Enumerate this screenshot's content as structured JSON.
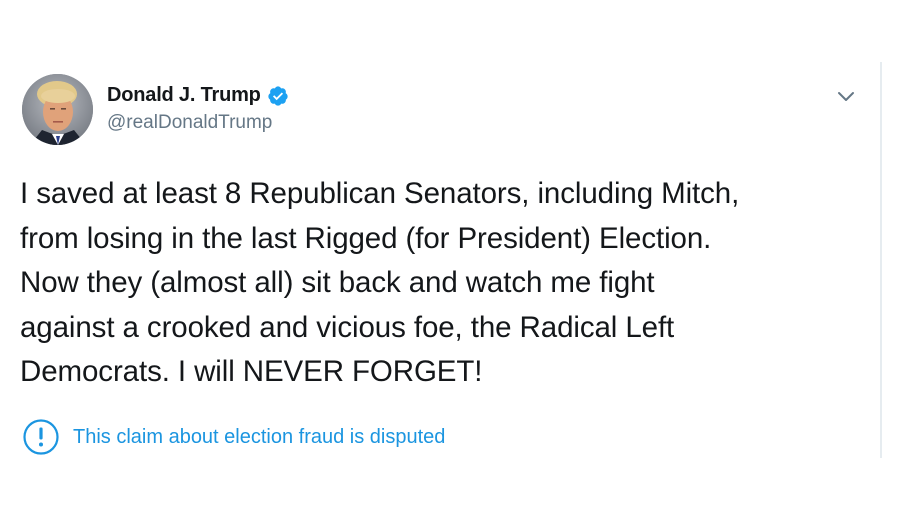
{
  "tweet": {
    "display_name": "Donald J. Trump",
    "handle": "@realDonaldTrump",
    "verified": true,
    "avatar_icon": "profile-photo",
    "text_lines": [
      "I saved at least 8 Republican Senators, including Mitch,",
      "from losing in the last Rigged (for President) Election.",
      "Now they (almost all) sit back and watch me fight",
      "against a crooked and vicious foe, the Radical Left",
      "Democrats. I will NEVER FORGET!"
    ],
    "notice": {
      "icon": "exclamation-circle-icon",
      "label": "This claim about election fraud is disputed"
    },
    "menu_icon": "chevron-down-icon"
  },
  "colors": {
    "accent": "#1b95e0",
    "verified": "#1da1f2",
    "secondary_text": "#657786",
    "primary_text": "#14171a",
    "divider": "#e6ecf0"
  }
}
